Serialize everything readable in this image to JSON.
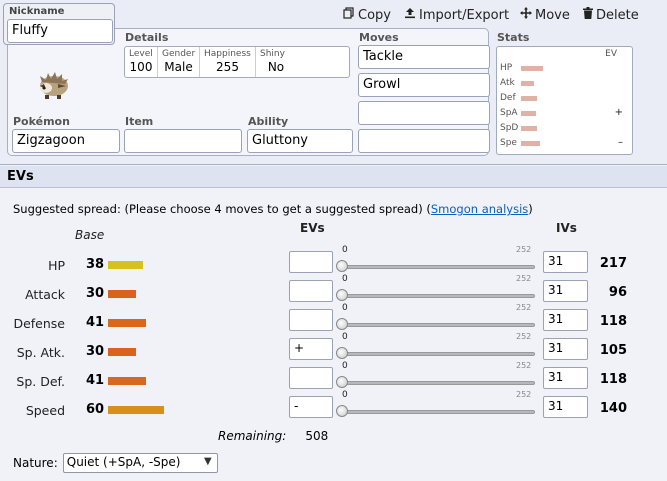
{
  "nickname": {
    "label": "Nickname",
    "value": "Fluffy"
  },
  "toolbar": {
    "copy": "Copy",
    "import_export": "Import/Export",
    "move": "Move",
    "delete": "Delete"
  },
  "details": {
    "label": "Details",
    "level_label": "Level",
    "level": "100",
    "gender_label": "Gender",
    "gender": "Male",
    "happiness_label": "Happiness",
    "happiness": "255",
    "shiny_label": "Shiny",
    "shiny": "No"
  },
  "pokemon": {
    "label": "Pokémon",
    "value": "Zigzagoon"
  },
  "item": {
    "label": "Item",
    "value": ""
  },
  "ability": {
    "label": "Ability",
    "value": "Gluttony"
  },
  "moves": {
    "label": "Moves",
    "list": [
      "Tackle",
      "Growl",
      "",
      ""
    ]
  },
  "stats_panel": {
    "label": "Stats",
    "ev_label": "EV",
    "rows": [
      {
        "name": "HP",
        "fraction": 0.55,
        "mark": ""
      },
      {
        "name": "Atk",
        "fraction": 0.33,
        "mark": ""
      },
      {
        "name": "Def",
        "fraction": 0.41,
        "mark": ""
      },
      {
        "name": "SpA",
        "fraction": 0.37,
        "mark": "+"
      },
      {
        "name": "SpD",
        "fraction": 0.41,
        "mark": ""
      },
      {
        "name": "Spe",
        "fraction": 0.47,
        "mark": "–"
      }
    ]
  },
  "ev_section": {
    "title": "EVs",
    "suggested_prefix": "Suggested spread: (Please choose 4 moves to get a suggested spread) (",
    "smogon_link": "Smogon analysis",
    "suggested_suffix": ")",
    "col_base": "Base",
    "col_evs": "EVs",
    "col_ivs": "IVs",
    "slider_min": "0",
    "slider_max": "252",
    "stats": [
      {
        "name": "HP",
        "base": "38",
        "base_fraction": 0.38,
        "color": "#d4c21e",
        "ev": "",
        "iv": "31",
        "total": "217"
      },
      {
        "name": "Attack",
        "base": "30",
        "base_fraction": 0.3,
        "color": "#d9621c",
        "ev": "",
        "iv": "31",
        "total": "96"
      },
      {
        "name": "Defense",
        "base": "41",
        "base_fraction": 0.41,
        "color": "#d9681c",
        "ev": "",
        "iv": "31",
        "total": "118"
      },
      {
        "name": "Sp. Atk.",
        "base": "30",
        "base_fraction": 0.3,
        "color": "#d9621c",
        "ev": "+",
        "iv": "31",
        "total": "105"
      },
      {
        "name": "Sp. Def.",
        "base": "41",
        "base_fraction": 0.41,
        "color": "#d9681c",
        "ev": "",
        "iv": "31",
        "total": "118"
      },
      {
        "name": "Speed",
        "base": "60",
        "base_fraction": 0.6,
        "color": "#da8c1d",
        "ev": "-",
        "iv": "31",
        "total": "140"
      }
    ],
    "remaining_label": "Remaining:",
    "remaining_value": "508",
    "nature_label": "Nature:",
    "nature_value": "Quiet (+SpA, -Spe)"
  },
  "colors": {
    "panel_bg": "#eaedf5",
    "link": "#0b5fbf",
    "stat_mini_bar": "#e0b1a5"
  }
}
